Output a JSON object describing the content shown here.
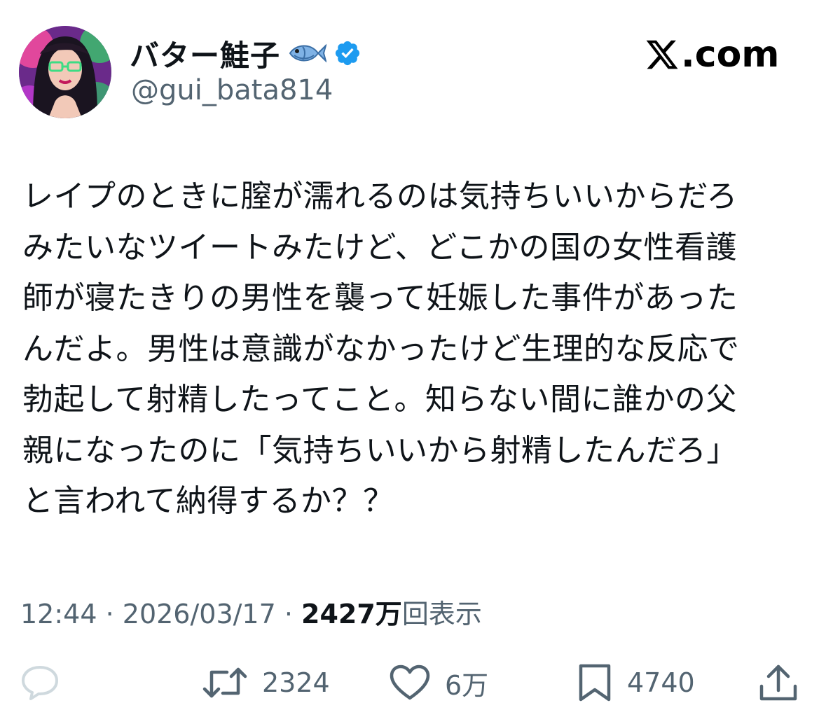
{
  "profile": {
    "display_name": "バター鮭子",
    "handle": "@gui_bata814",
    "name_emoji_icon": "fish-icon",
    "verified_icon": "verified-badge-icon"
  },
  "brand": {
    "label": ".com",
    "logo_icon": "x-logo-icon"
  },
  "tweet": {
    "lines": [
      "レイプのときに膣が濡れるのは気持ちいいからだろ",
      "みたいなツイートみたけど、どこかの国の女性看護",
      "師が寝たきりの男性を襲って妊娠した事件があった",
      "んだよ。男性は意識がなかったけど生理的な反応で",
      "勃起して射精したってこと。知らない間に誰かの父",
      "親になったのに「気持ちいいから射精したんだろ」",
      "と言われて納得するか？？"
    ]
  },
  "meta": {
    "time": "12:44",
    "separator": " · ",
    "date": "2026/03/17",
    "views_count": "2427万",
    "views_label": "回表示"
  },
  "actions": {
    "reply": {
      "icon": "reply-icon",
      "count": ""
    },
    "retweet": {
      "icon": "retweet-icon",
      "count": "2324"
    },
    "like": {
      "icon": "heart-icon",
      "count": "6万"
    },
    "bookmark": {
      "icon": "bookmark-icon",
      "count": "4740"
    },
    "share": {
      "icon": "share-icon"
    }
  },
  "colors": {
    "text": "#0f1419",
    "secondary": "#536471",
    "verified": "#1d9bf0",
    "reply_icon": "#cfd9de"
  }
}
